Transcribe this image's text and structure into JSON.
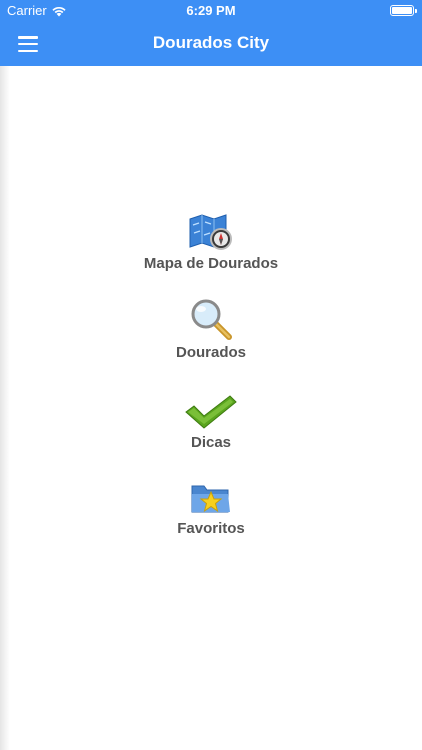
{
  "status_bar": {
    "carrier": "Carrier",
    "time": "6:29 PM"
  },
  "nav": {
    "title": "Dourados City",
    "menu_icon": "hamburger-icon"
  },
  "colors": {
    "nav_background": "#3d8ff5",
    "label_text": "#555555"
  },
  "menu_items": [
    {
      "label": "Mapa de Dourados",
      "icon": "map-compass-icon"
    },
    {
      "label": "Dourados",
      "icon": "magnifier-icon"
    },
    {
      "label": "Dicas",
      "icon": "checkmark-icon"
    },
    {
      "label": "Favoritos",
      "icon": "folder-star-icon"
    }
  ]
}
